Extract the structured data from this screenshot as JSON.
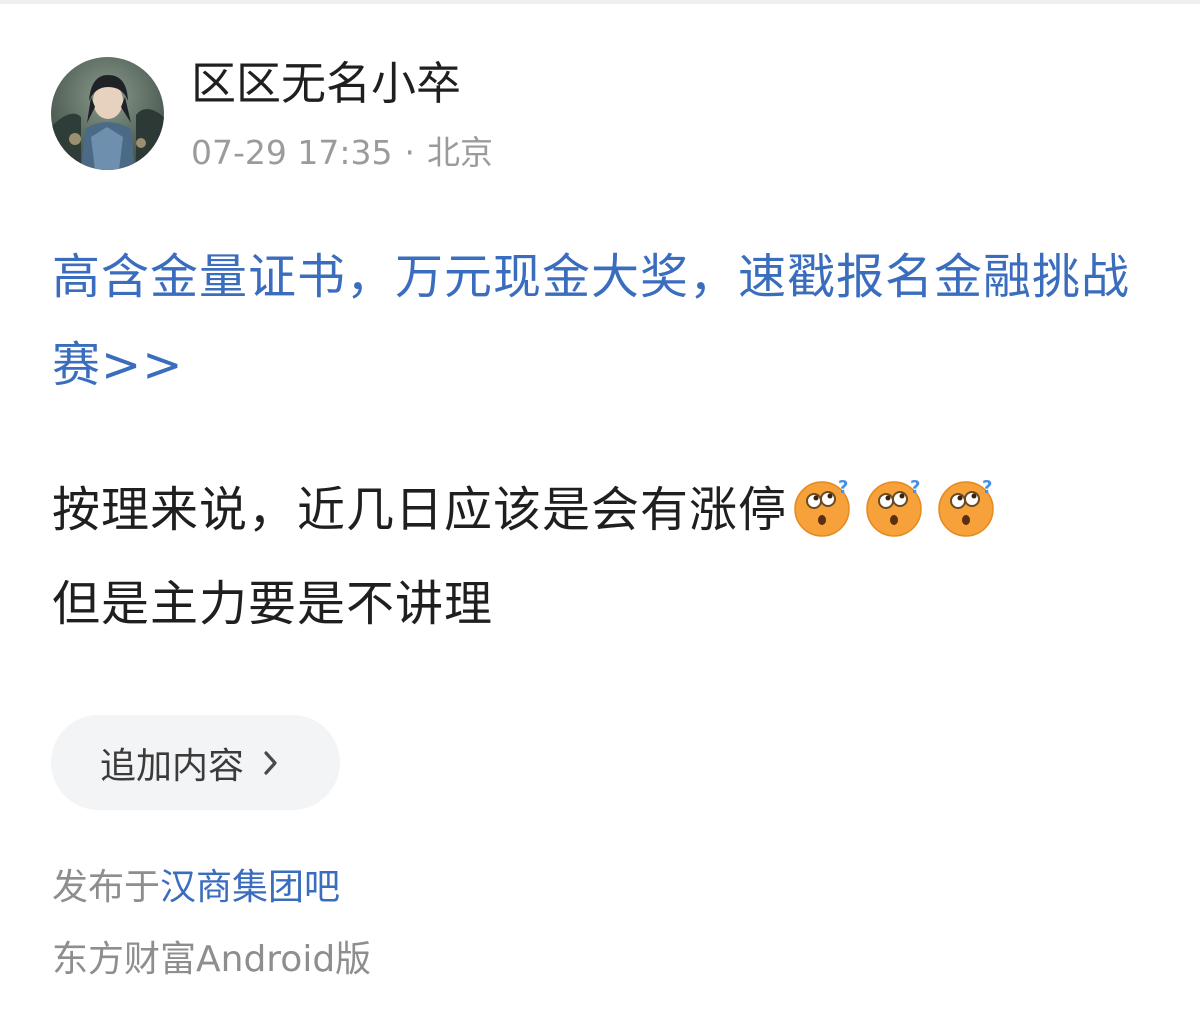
{
  "post": {
    "author": {
      "username": "区区无名小卒"
    },
    "timestamp": "07-29 17:35",
    "meta_separator": "·",
    "location": "北京",
    "promo_link": "高含金量证书，万元现金大奖，速戳报名金融挑战赛>>",
    "content": {
      "line1": "按理来说，近几日应该是会有涨停",
      "line2": "但是主力要是不讲理",
      "emojis": [
        "thinking-face-emoji",
        "thinking-face-emoji",
        "thinking-face-emoji"
      ]
    },
    "append_button": {
      "label": "追加内容",
      "icon": "chevron-right-icon"
    },
    "published_in": {
      "prefix": "发布于",
      "board": "汉商集团吧"
    },
    "client_source": "东方财富Android版"
  },
  "colors": {
    "link": "#3a6dbd",
    "text_primary": "#1f1f1f",
    "text_secondary": "#9b9b9b",
    "button_bg": "#f3f4f6"
  }
}
